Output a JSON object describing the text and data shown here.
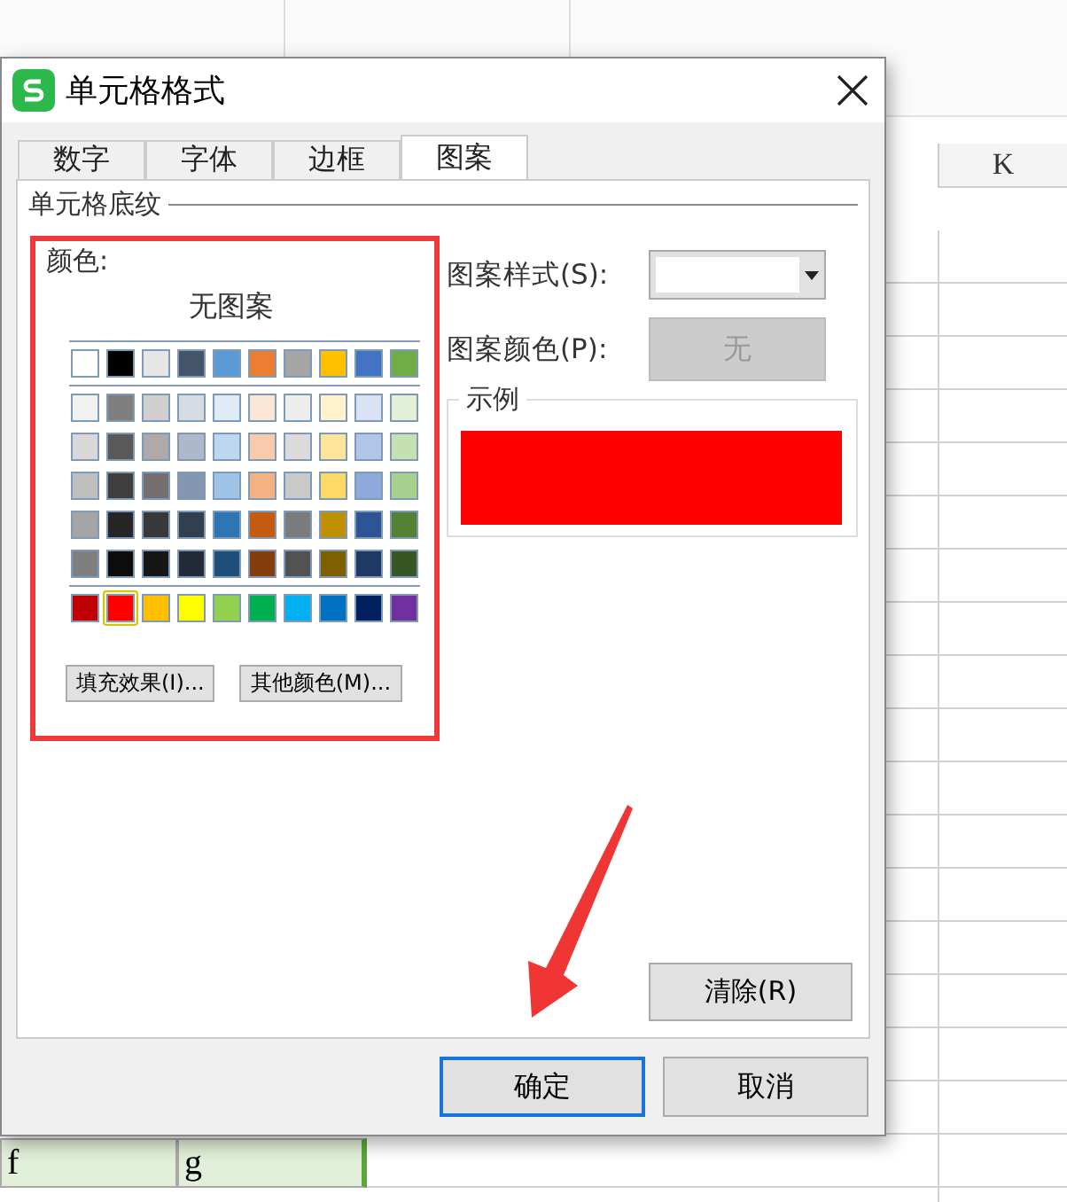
{
  "sheet": {
    "column_header": "K",
    "bottom_row": [
      {
        "text": "f",
        "selected": true
      },
      {
        "text": "g",
        "selected": true
      }
    ]
  },
  "dialog": {
    "title": "单元格格式",
    "tabs": [
      {
        "label": "数字",
        "selected": false
      },
      {
        "label": "字体",
        "selected": false
      },
      {
        "label": "边框",
        "selected": false
      },
      {
        "label": "图案",
        "selected": true
      }
    ],
    "group_title": "单元格底纹",
    "color_label": "颜色:",
    "no_pattern": "无图案",
    "theme_row": [
      {
        "color": "#ffffff",
        "selected": false
      },
      {
        "color": "#000000",
        "selected": false
      },
      {
        "color": "#e7e6e6",
        "selected": false
      },
      {
        "color": "#44546a",
        "selected": false
      },
      {
        "color": "#5b9bd5",
        "selected": false
      },
      {
        "color": "#ed7d31",
        "selected": false
      },
      {
        "color": "#a5a5a5",
        "selected": false
      },
      {
        "color": "#ffc000",
        "selected": false
      },
      {
        "color": "#4472c4",
        "selected": false
      },
      {
        "color": "#70ad47",
        "selected": false
      }
    ],
    "tint_rows": [
      [
        {
          "color": "#f2f2f2",
          "selected": false
        },
        {
          "color": "#7f7f7f",
          "selected": false
        },
        {
          "color": "#d0cece",
          "selected": false
        },
        {
          "color": "#d6dce4",
          "selected": false
        },
        {
          "color": "#deebf6",
          "selected": false
        },
        {
          "color": "#fbe5d5",
          "selected": false
        },
        {
          "color": "#ededed",
          "selected": false
        },
        {
          "color": "#fff2cc",
          "selected": false
        },
        {
          "color": "#d9e2f3",
          "selected": false
        },
        {
          "color": "#e2efd9",
          "selected": false
        }
      ],
      [
        {
          "color": "#d8d8d8",
          "selected": false
        },
        {
          "color": "#595959",
          "selected": false
        },
        {
          "color": "#aeaaaa",
          "selected": false
        },
        {
          "color": "#adb9ca",
          "selected": false
        },
        {
          "color": "#bdd7ee",
          "selected": false
        },
        {
          "color": "#f7cbac",
          "selected": false
        },
        {
          "color": "#dbdbdb",
          "selected": false
        },
        {
          "color": "#fee599",
          "selected": false
        },
        {
          "color": "#b4c6e7",
          "selected": false
        },
        {
          "color": "#c5e0b3",
          "selected": false
        }
      ],
      [
        {
          "color": "#bfbfbf",
          "selected": false
        },
        {
          "color": "#3f3f3f",
          "selected": false
        },
        {
          "color": "#757070",
          "selected": false
        },
        {
          "color": "#8496b0",
          "selected": false
        },
        {
          "color": "#9dc3e6",
          "selected": false
        },
        {
          "color": "#f4b183",
          "selected": false
        },
        {
          "color": "#c9c9c9",
          "selected": false
        },
        {
          "color": "#ffd965",
          "selected": false
        },
        {
          "color": "#8eaadb",
          "selected": false
        },
        {
          "color": "#a8d08d",
          "selected": false
        }
      ],
      [
        {
          "color": "#a5a5a5",
          "selected": false
        },
        {
          "color": "#262626",
          "selected": false
        },
        {
          "color": "#3a3838",
          "selected": false
        },
        {
          "color": "#323f4f",
          "selected": false
        },
        {
          "color": "#2e75b5",
          "selected": false
        },
        {
          "color": "#c55a11",
          "selected": false
        },
        {
          "color": "#7b7b7b",
          "selected": false
        },
        {
          "color": "#bf9000",
          "selected": false
        },
        {
          "color": "#2f5496",
          "selected": false
        },
        {
          "color": "#538135",
          "selected": false
        }
      ],
      [
        {
          "color": "#7f7f7f",
          "selected": false
        },
        {
          "color": "#0c0c0c",
          "selected": false
        },
        {
          "color": "#171616",
          "selected": false
        },
        {
          "color": "#222a35",
          "selected": false
        },
        {
          "color": "#1e4e79",
          "selected": false
        },
        {
          "color": "#833c0b",
          "selected": false
        },
        {
          "color": "#525252",
          "selected": false
        },
        {
          "color": "#7f6000",
          "selected": false
        },
        {
          "color": "#1f3864",
          "selected": false
        },
        {
          "color": "#375623",
          "selected": false
        }
      ]
    ],
    "standard_row": [
      {
        "color": "#c00000",
        "selected": false
      },
      {
        "color": "#ff0000",
        "selected": true
      },
      {
        "color": "#ffc000",
        "selected": false
      },
      {
        "color": "#ffff00",
        "selected": false
      },
      {
        "color": "#92d050",
        "selected": false
      },
      {
        "color": "#00b050",
        "selected": false
      },
      {
        "color": "#00b0f0",
        "selected": false
      },
      {
        "color": "#0070c0",
        "selected": false
      },
      {
        "color": "#002060",
        "selected": false
      },
      {
        "color": "#7030a0",
        "selected": false
      }
    ],
    "fill_effects_button": "填充效果(I)...",
    "more_colors_button": "其他颜色(M)...",
    "pattern_style": {
      "label": "图案样式(S):",
      "disabled": false
    },
    "pattern_color": {
      "label": "图案颜色(P):",
      "value": "无",
      "disabled": true
    },
    "sample": {
      "title": "示例",
      "color": "#ff0000"
    },
    "clear_button": "清除(R)",
    "ok_button": "确定",
    "cancel_button": "取消"
  }
}
